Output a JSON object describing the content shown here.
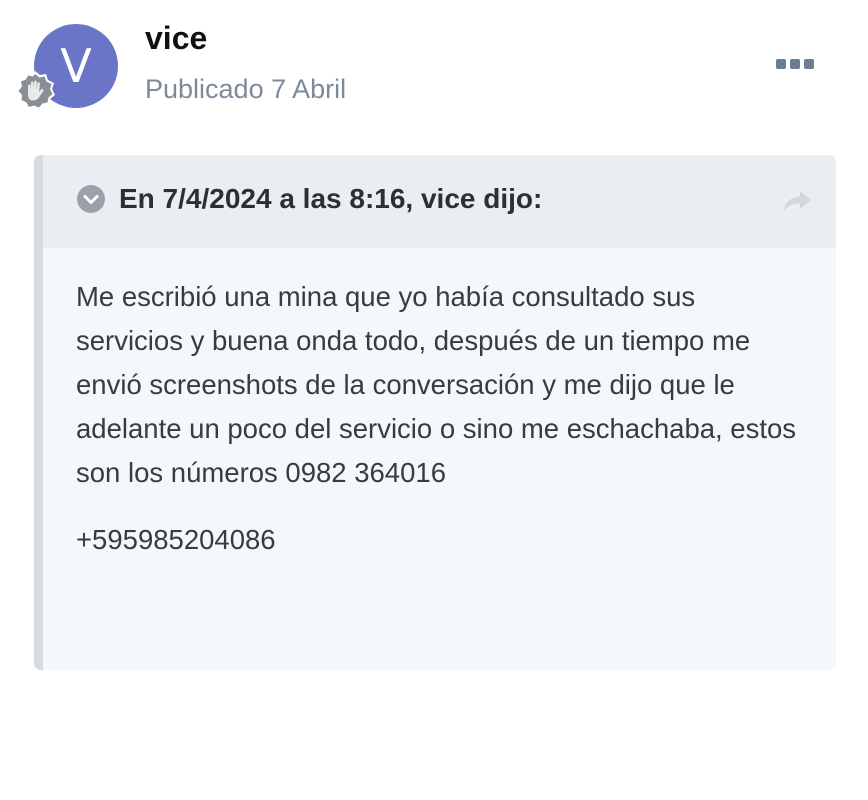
{
  "author": {
    "avatar_letter": "V",
    "avatar_color": "#6a75c8",
    "name": "vice",
    "posted": "Publicado 7 Abril",
    "badge_icon": "hand-badge-icon"
  },
  "menu": {
    "icon": "more-horizontal-icon"
  },
  "quote": {
    "citation": "En 7/4/2024 a las 8:16, vice dijo:",
    "collapse_icon": "chevron-down-circle-icon",
    "share_icon": "share-arrow-icon",
    "body": "Me escribió una mina que yo había consultado sus servicios y buena onda todo, después de un tiempo me envió screenshots de la conversación y me dijo que le adelante un poco del servicio o sino me eschachaba, estos son los números 0982 364016",
    "phone": "+595985204086"
  }
}
